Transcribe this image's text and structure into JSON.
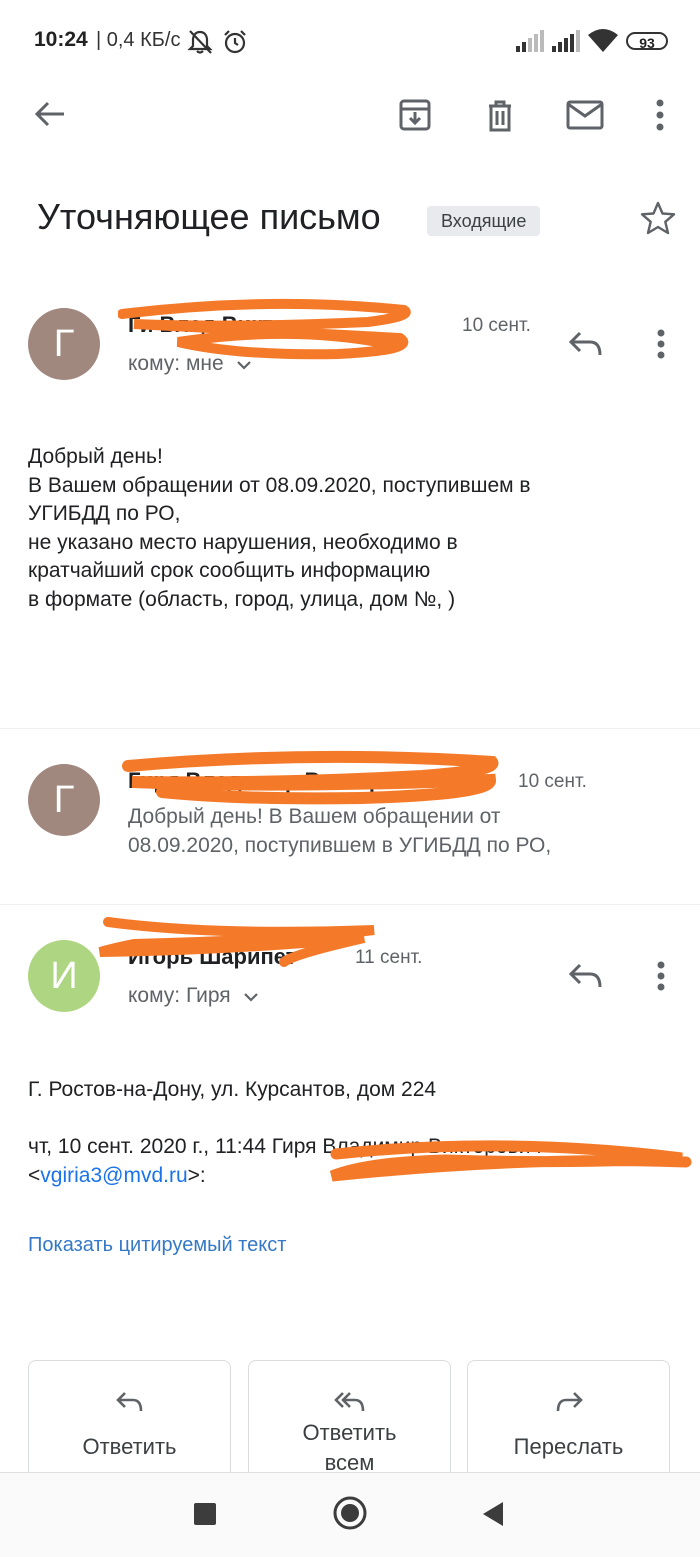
{
  "status_bar": {
    "time": "10:24",
    "network": "| 0,4 КБ/с",
    "battery": "93"
  },
  "toolbar": {
    "icons": [
      "back-arrow-icon",
      "archive-icon",
      "delete-icon",
      "mark-unread-icon",
      "more-vert-icon"
    ]
  },
  "subject": {
    "title": "Уточняющее письмо",
    "label": "Входящие"
  },
  "messages": [
    {
      "avatar_letter": "Г",
      "avatar_color": "#a1887f",
      "sender": "Ги  Влад  Викто…",
      "date": "10 сент.",
      "to": "кому: мне",
      "body_lines": [
        "Добрый день!",
        "В Вашем обращении от 08.09.2020, поступившем в",
        "УГИБДД по РО,",
        "не указано место нарушения, необходимо в",
        "кратчайший срок сообщить информацию",
        "в формате (область, город, улица, дом №, )"
      ]
    },
    {
      "avatar_letter": "Г",
      "avatar_color": "#a1887f",
      "sender": "Гиря Владимир Викторович",
      "date": "10 сент.",
      "snippet_lines": [
        "Добрый день! В Вашем обращении от",
        "08.09.2020, поступившем в УГИБДД по РО,"
      ]
    },
    {
      "avatar_letter": "И",
      "avatar_color": "#aed581",
      "sender": "Игорь Шарипет",
      "date": "11 сент.",
      "to": "кому: Гиря",
      "body_line": "Г. Ростов-на-Дону, ул. Курсантов, дом 224",
      "quote_header": "чт, 10 сент. 2020 г., 11:44 Гиря Владимир Викторович",
      "quote_email_open": "<",
      "quote_email": "vgiria3@mvd.ru",
      "quote_email_close": ">:",
      "show_quoted": "Показать цитируемый текст"
    }
  ],
  "actions": {
    "reply": "Ответить",
    "reply_all_line1": "Ответить",
    "reply_all_line2": "всем",
    "forward": "Переслать"
  },
  "colors": {
    "accent": "#1a73e8",
    "redaction": "#f47a2a"
  }
}
